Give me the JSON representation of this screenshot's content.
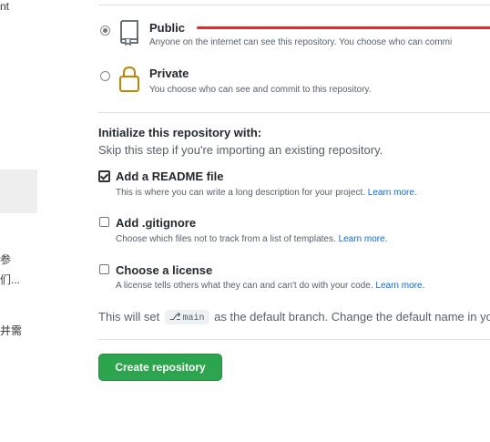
{
  "left_fragments": {
    "top": "nt",
    "mid1": "参",
    "mid2": "们...",
    "mid3": "并需"
  },
  "visibility": {
    "public": {
      "title": "Public",
      "description": "Anyone on the internet can see this repository. You choose who can commi",
      "selected": true
    },
    "private": {
      "title": "Private",
      "description": "You choose who can see and commit to this repository.",
      "selected": false
    }
  },
  "initialize": {
    "heading": "Initialize this repository with:",
    "subtext": "Skip this step if you're importing an existing repository.",
    "options": [
      {
        "title": "Add a README file",
        "description": "This is where you can write a long description for your project.",
        "link": "Learn more.",
        "checked": true
      },
      {
        "title": "Add .gitignore",
        "description": "Choose which files not to track from a list of templates.",
        "link": "Learn more.",
        "checked": false
      },
      {
        "title": "Choose a license",
        "description": "A license tells others what they can and can't do with your code.",
        "link": "Learn more.",
        "checked": false
      }
    ]
  },
  "branch": {
    "prefix": "This will set",
    "name": "main",
    "suffix": "as the default branch. Change the default name in yo"
  },
  "create_button": {
    "label": "Create repository"
  },
  "colors": {
    "primary_button": "#2da44e",
    "link": "#0969da",
    "annotation": "#e8262c"
  }
}
